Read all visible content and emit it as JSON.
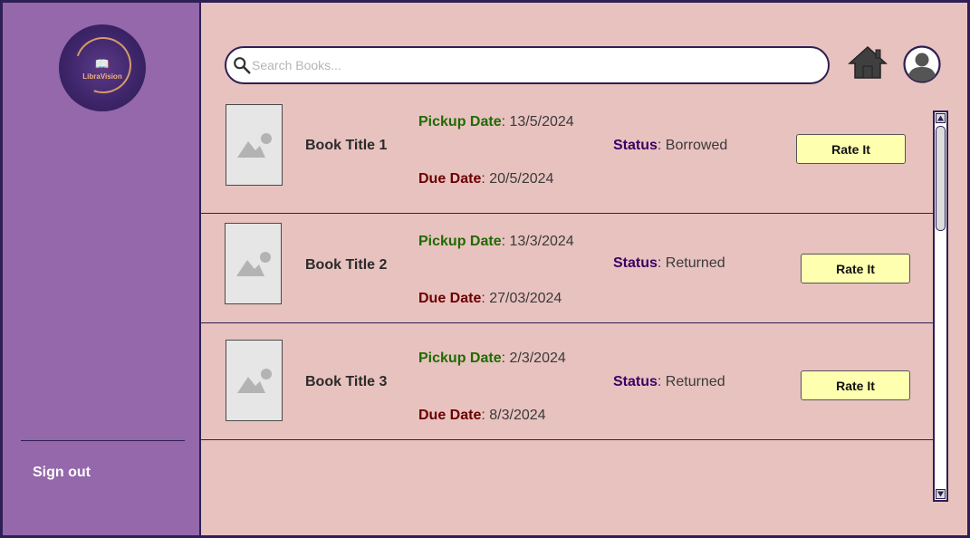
{
  "app": {
    "logo_text": "LibraVision",
    "sign_out_label": "Sign out"
  },
  "search": {
    "placeholder": "Search Books...",
    "value": ""
  },
  "icons": {
    "search": "search-icon",
    "home": "home-icon",
    "user": "user-avatar-icon",
    "image_placeholder": "image-placeholder-icon"
  },
  "labels": {
    "pickup_date": "Pickup Date",
    "due_date": "Due Date",
    "status": "Status",
    "separator": ": "
  },
  "books": [
    {
      "title": "Book Title 1",
      "pickup_date": "13/5/2024",
      "due_date": "20/5/2024",
      "status": "Borrowed",
      "action": "Rate It"
    },
    {
      "title": "Book Title 2",
      "pickup_date": "13/3/2024",
      "due_date": "27/03/2024",
      "status": "Returned",
      "action": "Rate It"
    },
    {
      "title": "Book Title 3",
      "pickup_date": "2/3/2024",
      "due_date": "8/3/2024",
      "status": "Returned",
      "action": "Rate It"
    }
  ],
  "colors": {
    "sidebar": "#9468aa",
    "content_bg": "#e8c2bf",
    "border": "#2e1f55",
    "pickup_label": "#1f6b00",
    "due_label": "#6b0000",
    "status_label": "#3b0063",
    "button_bg": "#ffffb0"
  }
}
